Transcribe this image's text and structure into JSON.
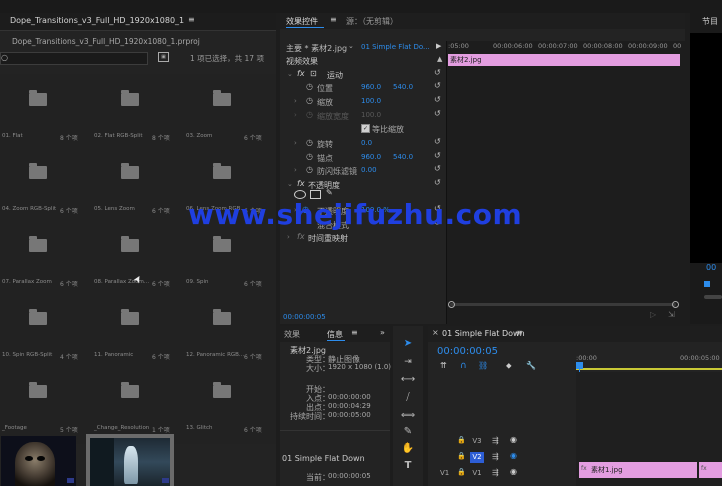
{
  "project": {
    "tab_title": "Dope_Transitions_v3_Full_HD_1920x1080_1",
    "menu_icon": "≡",
    "file_name": "Dope_Transitions_v3_Full_HD_1920x1080_1.prproj",
    "selection_info": "1 项已选择，共 17 项",
    "bins": [
      {
        "name": "01. Flat",
        "count": "8 个项"
      },
      {
        "name": "02. Flat RGB-Split",
        "count": "8 个项"
      },
      {
        "name": "03. Zoom",
        "count": "6 个项"
      },
      {
        "name": "04. Zoom RGB-Split",
        "count": "6 个项"
      },
      {
        "name": "05. Lens Zoom",
        "count": "6 个项"
      },
      {
        "name": "06. Lens Zoom RGB...",
        "count": "6 个项"
      },
      {
        "name": "07. Parallax Zoom",
        "count": "6 个项"
      },
      {
        "name": "08. Parallax Zoom...",
        "count": "6 个项"
      },
      {
        "name": "09. Spin",
        "count": "6 个项"
      },
      {
        "name": "10. Spin RGB-Split",
        "count": "4 个项"
      },
      {
        "name": "11. Panoramic",
        "count": "6 个项"
      },
      {
        "name": "12. Panoramic RGB...",
        "count": "6 个项"
      },
      {
        "name": "_Footage",
        "count": "5 个项"
      },
      {
        "name": "_Change_Resolution",
        "count": "1 个项"
      },
      {
        "name": "13. Glitch",
        "count": "6 个项"
      }
    ]
  },
  "effect_controls": {
    "tab_active": "效果控件",
    "tab_menu": "≡",
    "tab_other": "源：（无剪辑）",
    "master_label": "主要 * 素材2.jpg",
    "sequence_label": "01 Simple Flat Do...",
    "video_effects": "视频效果",
    "motion": "运动",
    "position_label": "位置",
    "position_x": "960.0",
    "position_y": "540.0",
    "scale_label": "缩放",
    "scale_value": "100.0",
    "scale_width_label": "缩放宽度",
    "scale_width_value": "100.0",
    "uniform_scale": "等比缩放",
    "rotation_label": "旋转",
    "rotation_value": "0.0",
    "anchor_label": "锚点",
    "anchor_x": "960.0",
    "anchor_y": "540.0",
    "antiflicker_label": "防闪烁滤镜",
    "antiflicker_value": "0.00",
    "opacity_group": "不透明度",
    "opacity_label": "不透明度",
    "opacity_value": "100.0 %",
    "blend_label": "混合模式",
    "time_remap": "时间重映射",
    "timecode": "00:00:00:05",
    "clip_name": "素材2.jpg",
    "ruler": [
      ":05:00",
      "00:00:06:00",
      "00:00:07:00",
      "00:00:08:00",
      "00:00:09:00",
      "00"
    ]
  },
  "program": {
    "title": "节目",
    "timecode_partial": "00"
  },
  "info_panel": {
    "tab_effects": "效果",
    "tab_info": "信息",
    "tab_menu": "≡",
    "clip_name": "素材2.jpg",
    "type_label": "类型：",
    "type_value": "静止图像",
    "size_label": "大小：",
    "size_value": "1920 x 1080 (1.0)",
    "start_label": "开始：",
    "in_label": "入点：",
    "in_value": "00:00:00:00",
    "out_label": "出点：",
    "out_value": "00:00:04:29",
    "dur_label": "持续时间：",
    "dur_value": "00:00:05:00",
    "sequence_name": "01 Simple Flat Down",
    "current_label": "当前：",
    "current_value": "00:00:00:05"
  },
  "timeline": {
    "close": "×",
    "sequence_name": "01 Simple Flat Down",
    "menu_icon": "≡",
    "timecode": "00:00:00:05",
    "ruler": [
      ":00:00",
      "00:00:05:00"
    ],
    "tracks": [
      {
        "src": "",
        "name": "V3"
      },
      {
        "src": "",
        "name": "V2"
      },
      {
        "src": "V1",
        "name": "V1"
      }
    ],
    "clip_v1": "素材1.jpg",
    "clip_v1_fx": "fx"
  },
  "watermark": "www.shejifuzhu.com",
  "colors": {
    "accent": "#2d8ceb",
    "clip_pink": "#e39de0",
    "watermark": "#1f3fe0"
  }
}
